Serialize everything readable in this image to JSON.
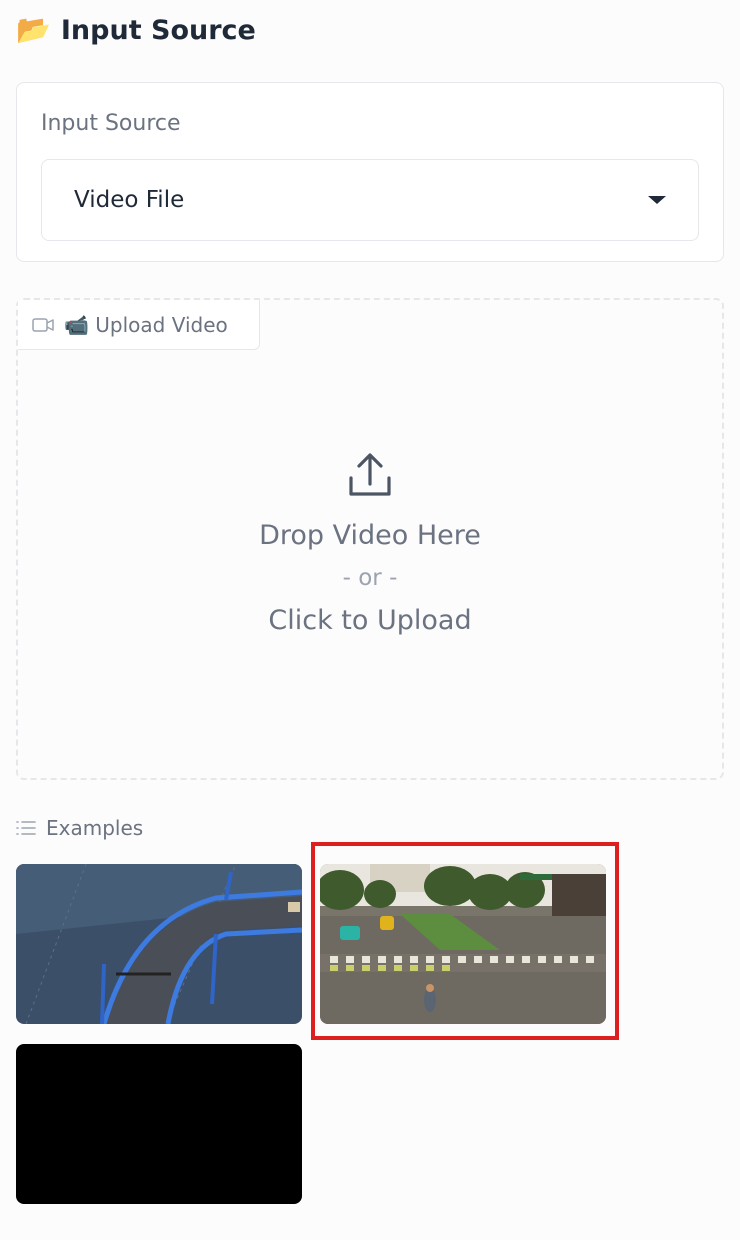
{
  "section": {
    "icon": "open-folder-icon",
    "title": "Input Source"
  },
  "input_source": {
    "label": "Input Source",
    "selected": "Video File"
  },
  "upload": {
    "tab_label": "📹 Upload Video",
    "drop_text": "Drop Video Here",
    "or_text": "- or -",
    "click_text": "Click to Upload"
  },
  "examples": {
    "label": "Examples",
    "items": [
      {
        "name": "conveyor-track-video"
      },
      {
        "name": "street-intersection-video",
        "highlighted": true
      },
      {
        "name": "black-video"
      }
    ]
  },
  "colors": {
    "highlight": "#dc1f1f",
    "accent": "#f59e0b"
  }
}
